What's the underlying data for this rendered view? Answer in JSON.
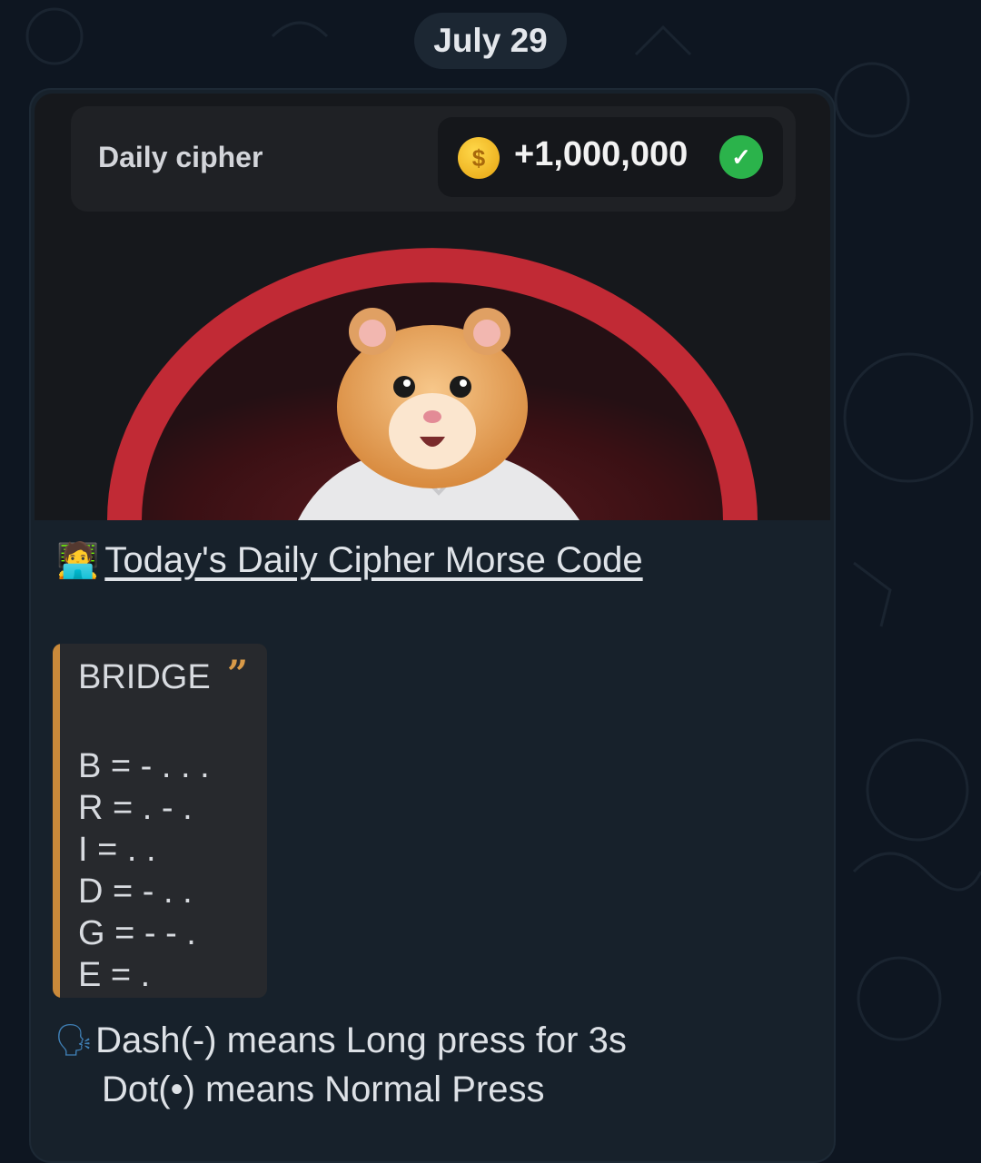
{
  "date_chip": "July 29",
  "preview": {
    "title": "Daily cipher",
    "reward": "+1,000,000",
    "coin_symbol": "$",
    "check_symbol": "✓"
  },
  "message": {
    "link_emoji": "🧑‍💻",
    "link_text": "Today's Daily Cipher Morse Code",
    "quote_title": "BRIDGE",
    "quote_mark": "”",
    "code_lines": [
      "B = - . . .",
      "R = . - .",
      "I = . .",
      "D = - . .",
      "G = - - .",
      "E = ."
    ],
    "speak_icon": "🗣",
    "instruction_1": "Dash(-) means Long press for 3s",
    "instruction_2": "Dot(•) means Normal Press"
  },
  "colors": {
    "background": "#0e1621",
    "bubble": "#17212b",
    "quote_accent": "#c9893a",
    "check_green": "#2bb34b",
    "coin_gold": "#f2b820"
  }
}
